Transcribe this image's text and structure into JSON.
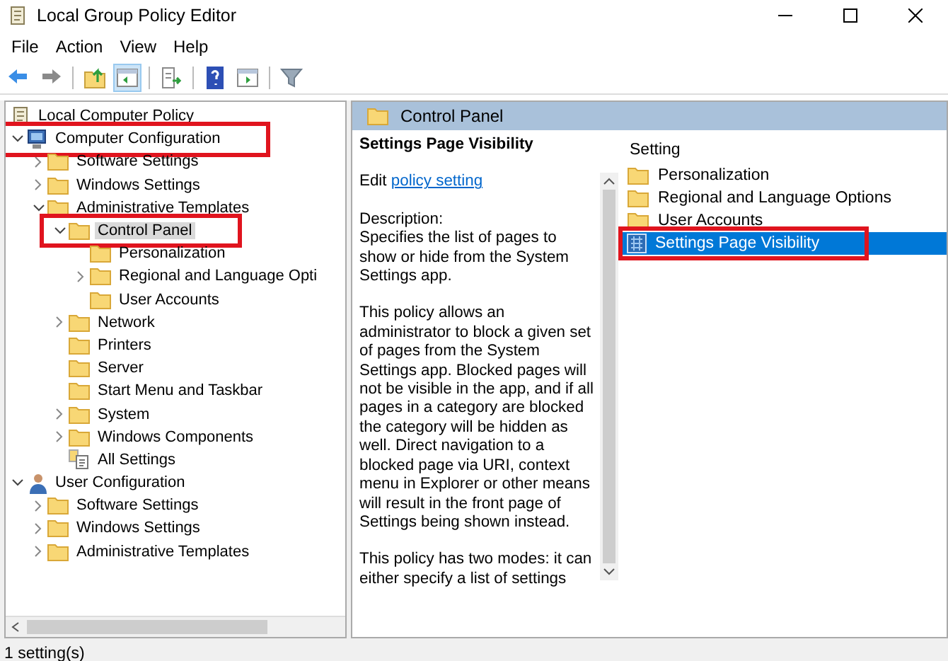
{
  "window": {
    "title": "Local Group Policy Editor"
  },
  "menu": [
    "File",
    "Action",
    "View",
    "Help"
  ],
  "toolbar": [
    {
      "kind": "back",
      "pressed": false
    },
    {
      "kind": "forward",
      "pressed": false
    },
    {
      "kind": "up",
      "pressed": false
    },
    {
      "kind": "tree",
      "pressed": true
    },
    {
      "kind": "export",
      "pressed": false
    },
    {
      "kind": "help",
      "pressed": false
    },
    {
      "kind": "pane",
      "pressed": false
    },
    {
      "kind": "filter",
      "pressed": false
    }
  ],
  "tree": {
    "label": "Local Computer Policy",
    "kind": "policy",
    "children": [
      {
        "label": "Computer Configuration",
        "kind": "computer",
        "expanded": true,
        "selected": false,
        "highlighted": true,
        "children": [
          {
            "label": "Software Settings",
            "kind": "folder",
            "expanded": false,
            "selected": false,
            "highlighted": false
          },
          {
            "label": "Windows Settings",
            "kind": "folder",
            "expanded": false,
            "selected": false,
            "highlighted": false
          },
          {
            "label": "Administrative Templates",
            "kind": "folder",
            "expanded": true,
            "selected": false,
            "highlighted": false,
            "children": [
              {
                "label": "Control Panel",
                "kind": "folder",
                "expanded": true,
                "selected": true,
                "highlighted": true,
                "children": [
                  {
                    "label": "Personalization",
                    "kind": "folder",
                    "selected": false,
                    "highlighted": false
                  },
                  {
                    "label": "Regional and Language Opti",
                    "kind": "folder",
                    "expanded": false,
                    "selected": false,
                    "highlighted": false
                  },
                  {
                    "label": "User Accounts",
                    "kind": "folder",
                    "selected": false,
                    "highlighted": false
                  }
                ]
              },
              {
                "label": "Network",
                "kind": "folder",
                "expanded": false,
                "selected": false,
                "highlighted": false
              },
              {
                "label": "Printers",
                "kind": "folder",
                "selected": false,
                "highlighted": false
              },
              {
                "label": "Server",
                "kind": "folder",
                "selected": false,
                "highlighted": false
              },
              {
                "label": "Start Menu and Taskbar",
                "kind": "folder",
                "selected": false,
                "highlighted": false
              },
              {
                "label": "System",
                "kind": "folder",
                "expanded": false,
                "selected": false,
                "highlighted": false
              },
              {
                "label": "Windows Components",
                "kind": "folder",
                "expanded": false,
                "selected": false,
                "highlighted": false
              },
              {
                "label": "All Settings",
                "kind": "settings",
                "selected": false,
                "highlighted": false
              }
            ]
          }
        ]
      },
      {
        "label": "User Configuration",
        "kind": "user",
        "expanded": true,
        "selected": false,
        "highlighted": false,
        "children": [
          {
            "label": "Software Settings",
            "kind": "folder",
            "expanded": false,
            "selected": false,
            "highlighted": false
          },
          {
            "label": "Windows Settings",
            "kind": "folder",
            "expanded": false,
            "selected": false,
            "highlighted": false
          },
          {
            "label": "Administrative Templates",
            "kind": "folder",
            "expanded": false,
            "selected": false,
            "highlighted": false
          }
        ]
      }
    ]
  },
  "detail": {
    "header": "Control Panel",
    "title": "Settings Page Visibility",
    "edit_prefix": "Edit",
    "edit_link": "policy setting",
    "paragraphs": [
      "Description:\nSpecifies the list of pages to show or hide from the System Settings app.",
      "This policy allows an administrator to block a given set of pages from the System Settings app. Blocked pages will not be visible in the app, and if all pages in a category are blocked the category will be hidden as well. Direct navigation to a blocked page via URI, context menu in Explorer or other means will result in the front page of Settings being shown instead.",
      "This policy has two modes: it can either specify a list of settings"
    ]
  },
  "list": {
    "column": "Setting",
    "items": [
      {
        "label": "Personalization",
        "kind": "folder",
        "selected": false,
        "highlighted": false
      },
      {
        "label": "Regional and Language Options",
        "kind": "folder",
        "selected": false,
        "highlighted": false
      },
      {
        "label": "User Accounts",
        "kind": "folder",
        "selected": false,
        "highlighted": false
      },
      {
        "label": "Settings Page Visibility",
        "kind": "setting",
        "selected": true,
        "highlighted": true
      }
    ]
  },
  "status_bar": "1 setting(s)"
}
